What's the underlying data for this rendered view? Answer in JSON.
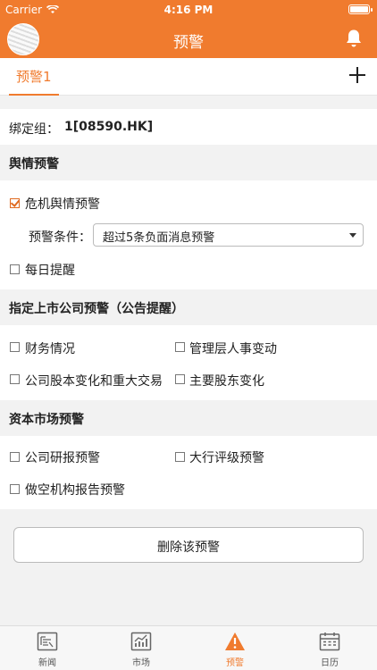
{
  "status": {
    "carrier": "Carrier",
    "time": "4:16 PM"
  },
  "nav": {
    "title": "预警"
  },
  "tabs": [
    {
      "label": "预警1",
      "active": true
    }
  ],
  "binding": {
    "label": "绑定组：",
    "value": "1[08590.HK]"
  },
  "sentiment": {
    "header": "舆情预警",
    "crisis_label": "危机舆情预警",
    "crisis_checked": true,
    "condition_label": "预警条件：",
    "condition_value": "超过5条负面消息预警",
    "daily_label": "每日提醒",
    "daily_checked": false
  },
  "listed_company": {
    "header": "指定上市公司预警（公告提醒）",
    "options": [
      {
        "label": " 财务情况",
        "checked": false
      },
      {
        "label": "管理层人事变动",
        "checked": false
      },
      {
        "label": "公司股本变化和重大交易",
        "checked": false
      },
      {
        "label": "主要股东变化",
        "checked": false
      }
    ]
  },
  "capital_market": {
    "header": "资本市场预警",
    "options": [
      {
        "label": "公司研报预警",
        "checked": false
      },
      {
        "label": "大行评级预警",
        "checked": false
      },
      {
        "label": "做空机构报告预警",
        "checked": false
      }
    ]
  },
  "delete_label": "删除该预警",
  "tabbar": [
    {
      "label": "新闻",
      "icon": "news-icon",
      "active": false
    },
    {
      "label": "市场",
      "icon": "market-chart-icon",
      "active": false
    },
    {
      "label": "预警",
      "icon": "warning-icon",
      "active": true
    },
    {
      "label": "日历",
      "icon": "calendar-icon",
      "active": false
    }
  ],
  "colors": {
    "accent": "#f07b2e",
    "background": "#f2f2f2"
  }
}
